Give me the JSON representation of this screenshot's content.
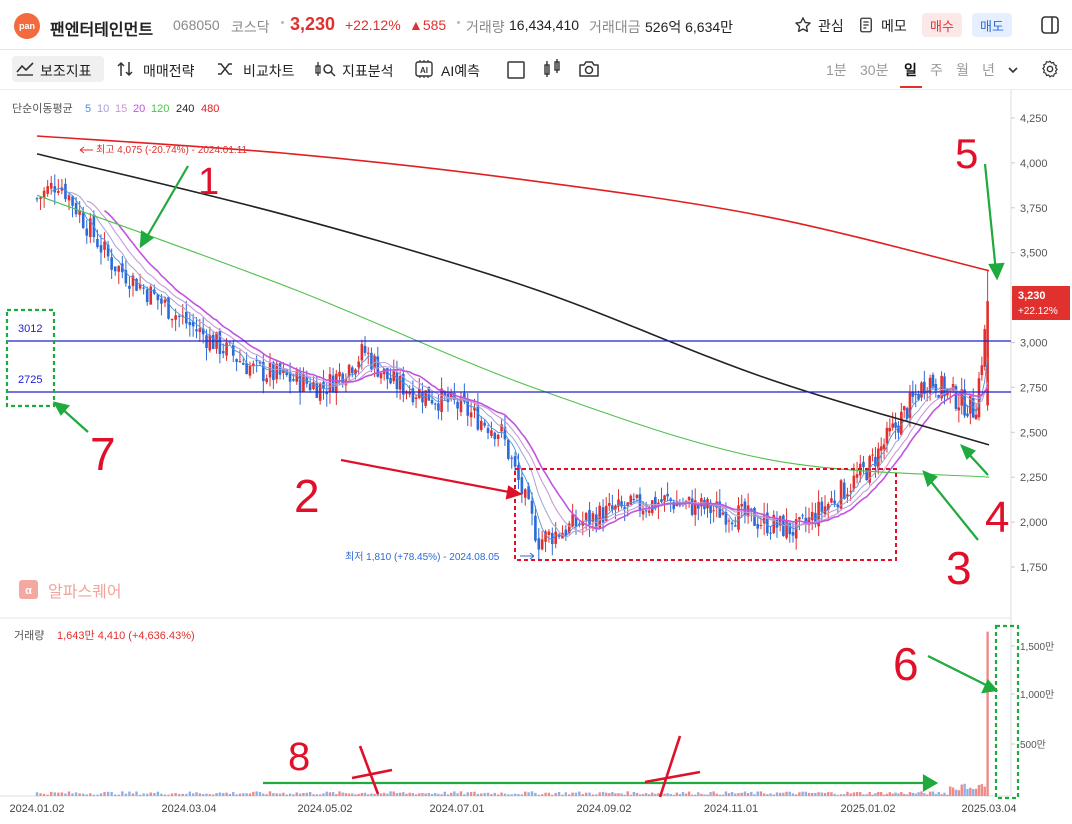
{
  "header": {
    "logo_text": "pan",
    "stock_name": "팬엔터테인먼트",
    "stock_code": "068050",
    "market": "코스닥",
    "price": "3,230",
    "change_pct": "+22.12%",
    "change_abs": "▲585",
    "volume_label": "거래량",
    "volume_value": "16,434,410",
    "amount_label": "거래대금",
    "amount_value": "526억 6,634만",
    "watch_label": "관심",
    "memo_label": "메모",
    "buy_label": "매수",
    "sell_label": "매도"
  },
  "toolbar": {
    "indicator_label": "보조지표",
    "strategy_label": "매매전략",
    "compare_label": "비교차트",
    "analysis_label": "지표분석",
    "ai_label": "AI예측",
    "periods": [
      "1분",
      "30분",
      "일",
      "주",
      "월",
      "년"
    ],
    "active_period": "일"
  },
  "chart": {
    "ma_legend_title": "단순이동평균",
    "ma_periods": [
      {
        "label": "5",
        "color": "#4a90e2"
      },
      {
        "label": "10",
        "color": "#a3a3d6"
      },
      {
        "label": "15",
        "color": "#c59ad9"
      },
      {
        "label": "20",
        "color": "#c154e0"
      },
      {
        "label": "120",
        "color": "#4ec24e"
      },
      {
        "label": "240",
        "color": "#222222"
      },
      {
        "label": "480",
        "color": "#e02020"
      }
    ],
    "high_note": "최고 4,075 (-20.74%) - 2024.01.11",
    "low_note": "최저 1,810 (+78.45%) - 2024.08.05",
    "hline_labels": [
      "3012",
      "2725"
    ],
    "watermark": "알파스퀘어",
    "price_tag": "3,230",
    "price_tag_pct": "+22.12%",
    "volume_legend_label": "거래량",
    "volume_legend_value": "1,643만 4,410 (+4,636.43%)",
    "colors": {
      "up": "#e0312f",
      "down": "#2b6ad8",
      "hline": "#2222cc",
      "annotation_red": "#e0102a",
      "annotation_green": "#1eaa3c"
    }
  },
  "y_axis": [
    "4,250",
    "4,000",
    "3,750",
    "3,500",
    "3,250",
    "3,000",
    "2,750",
    "2,500",
    "2,250",
    "2,000",
    "1,750"
  ],
  "vol_axis": [
    "1,500만",
    "1,000만",
    "500만"
  ],
  "x_axis": [
    "2024.01.02",
    "2024.03.04",
    "2024.05.02",
    "2024.07.01",
    "2024.09.02",
    "2024.11.01",
    "2025.01.02",
    "2025.03.04"
  ],
  "annotations": [
    "1",
    "2",
    "3",
    "4",
    "5",
    "6",
    "7",
    "8"
  ],
  "chart_data": {
    "type": "candlestick",
    "title": "",
    "ylim": [
      1650,
      4350
    ],
    "y_ticks": [
      4250,
      4000,
      3750,
      3500,
      3250,
      3000,
      2750,
      2500,
      2250,
      2000,
      1750
    ],
    "x_ticks": [
      "2024.01.02",
      "2024.03.04",
      "2024.05.02",
      "2024.07.01",
      "2024.09.02",
      "2024.11.01",
      "2025.01.02",
      "2025.03.04"
    ],
    "close_path": [
      [
        "2024.01.02",
        3800
      ],
      [
        "2024.01.11",
        3900
      ],
      [
        "2024.02.01",
        3450
      ],
      [
        "2024.03.04",
        3100
      ],
      [
        "2024.04.01",
        2850
      ],
      [
        "2024.05.02",
        2750
      ],
      [
        "2024.05.20",
        2950
      ],
      [
        "2024.06.01",
        2780
      ],
      [
        "2024.07.01",
        2650
      ],
      [
        "2024.07.20",
        2500
      ],
      [
        "2024.08.05",
        1900
      ],
      [
        "2024.09.02",
        2050
      ],
      [
        "2024.10.01",
        2120
      ],
      [
        "2024.11.01",
        2050
      ],
      [
        "2024.12.01",
        1950
      ],
      [
        "2025.01.02",
        2300
      ],
      [
        "2025.02.01",
        2800
      ],
      [
        "2025.02.25",
        2620
      ],
      [
        "2025.03.04",
        3230
      ]
    ],
    "ma_lines": [
      {
        "name": "480",
        "values": [
          4150,
          4050,
          3900,
          3700,
          3400
        ]
      },
      {
        "name": "240",
        "values": [
          4050,
          3700,
          3300,
          2800,
          2430
        ]
      },
      {
        "name": "120",
        "values": [
          3820,
          3300,
          2750,
          2350,
          2250
        ]
      }
    ],
    "high": {
      "value": 4075,
      "date": "2024.01.11"
    },
    "low": {
      "value": 1810,
      "date": "2024.08.05"
    },
    "hlines": [
      3012,
      2725
    ],
    "last": {
      "price": 3230,
      "change_pct": 22.12
    },
    "volume_last": 16434410
  }
}
